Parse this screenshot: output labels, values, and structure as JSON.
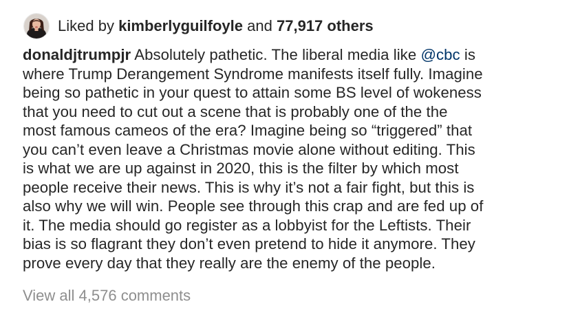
{
  "likes": {
    "prefix": "Liked by",
    "user": "kimberlyguilfoyle",
    "connector": "and",
    "others": "77,917 others"
  },
  "avatar": {
    "icon": "profile-photo-icon"
  },
  "caption": {
    "author": "donaldjtrumpjr",
    "mention": "@cbc",
    "lines": [
      "Absolutely pathetic. The liberal media like",
      "is",
      "where Trump Derangement Syndrome manifests itself fully. Imagine",
      "being so pathetic in your quest to attain some BS level of wokeness",
      "that you need to cut out a scene that is probably one of the the",
      "most famous cameos of the era? Imagine being so “triggered” that",
      "you can’t even leave a Christmas movie alone without editing. This",
      "is what we are up against in 2020, this is the filter by which most",
      "people receive their news. This is why it’s not a fair fight, but this is",
      "also why we will win. People see through this crap and are fed up of",
      "it. The media should go register as a lobbyist for the Leftists. Their",
      "bias is so flagrant they don’t even pretend to hide it anymore. They",
      "prove every day that they really are the enemy of the people."
    ]
  },
  "comments": {
    "view_all_label": "View all 4,576 comments"
  },
  "colors": {
    "text": "#262626",
    "mention": "#003569",
    "muted": "#8e8e8e"
  }
}
